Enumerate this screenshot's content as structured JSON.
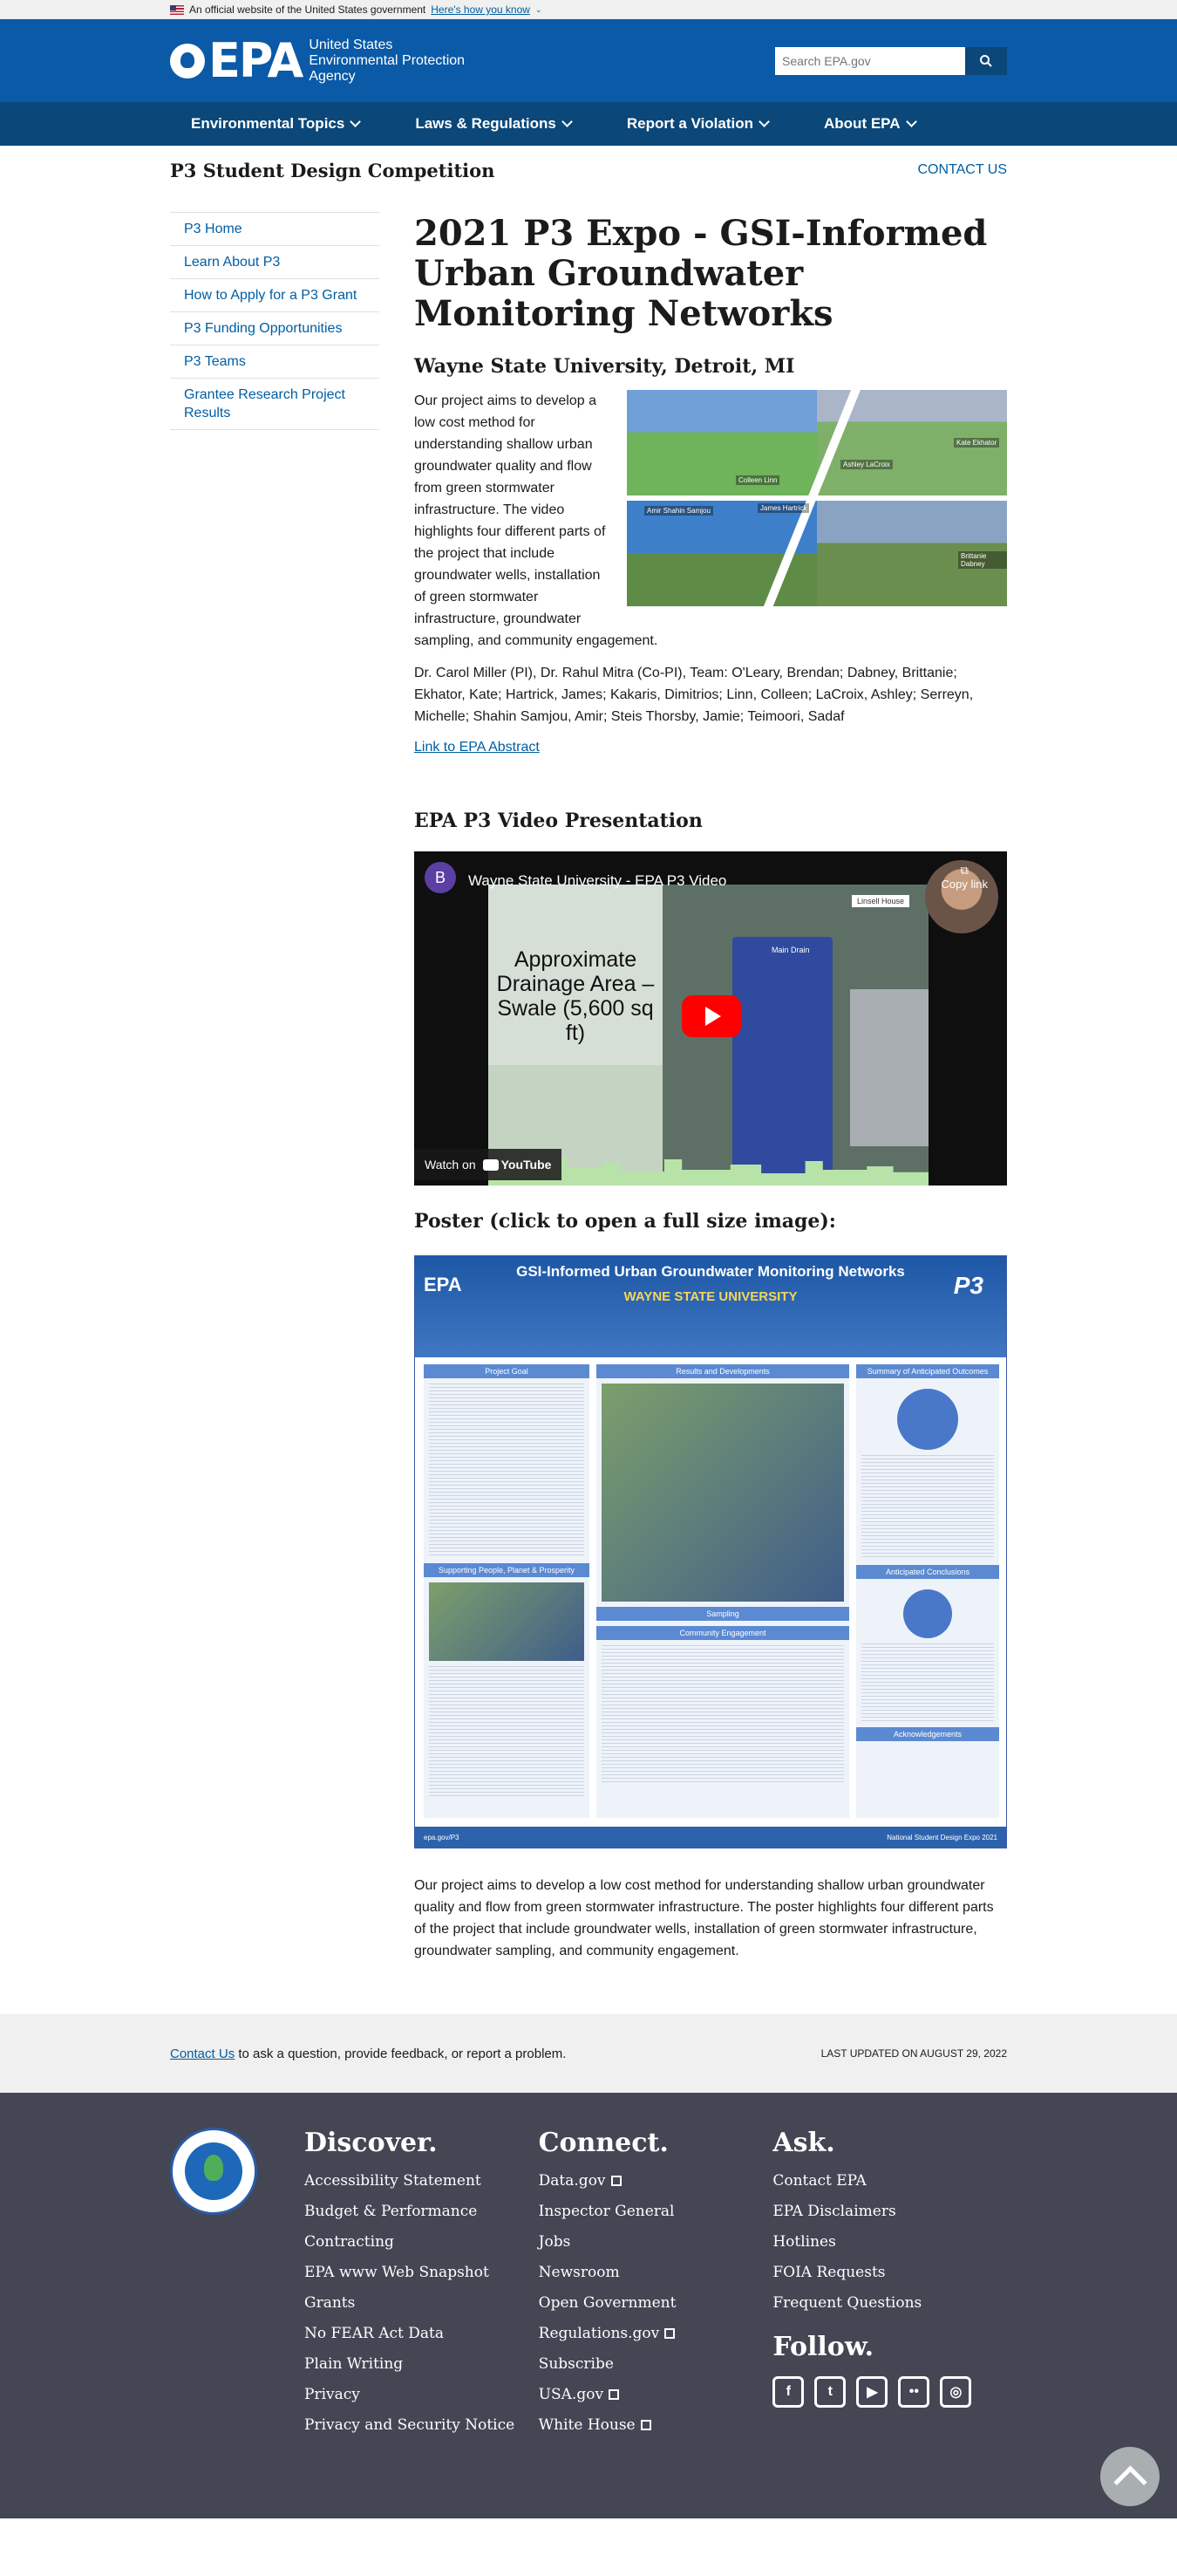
{
  "gov_banner": {
    "text": "An official website of the United States government",
    "link": "Here's how you know"
  },
  "header": {
    "logo": "EPA",
    "agency_name": [
      "United States",
      "Environmental Protection",
      "Agency"
    ],
    "search_placeholder": "Search EPA.gov"
  },
  "nav": {
    "items": [
      "Environmental Topics",
      "Laws & Regulations",
      "Report a Violation",
      "About EPA"
    ]
  },
  "microsite": {
    "title": "P3 Student Design Competition",
    "contact": "CONTACT US"
  },
  "sidebar": {
    "items": [
      "P3 Home",
      "Learn About P3",
      "How to Apply for a P3 Grant",
      "P3 Funding Opportunities",
      "P3 Teams",
      "Grantee Research Project Results"
    ]
  },
  "page": {
    "title": "2021 P3 Expo - GSI-Informed Urban Groundwater Monitoring Networks",
    "subtitle": "Wayne State University, Detroit, MI",
    "intro": "Our project aims to develop a low cost method for understanding shallow urban groundwater quality and flow from green stormwater infrastructure. The video highlights four different parts of the project that include groundwater wells, installation of green stormwater infrastructure, groundwater sampling, and community engagement.",
    "team": "Dr. Carol Miller (PI), Dr. Rahul Mitra (Co-PI), Team: O'Leary, Brendan; Dabney, Brittanie; Ekhator, Kate; Hartrick, James; Kakaris, Dimitrios; Linn, Colleen; LaCroix, Ashley; Serreyn, Michelle; Shahin Samjou, Amir; Steis Thorsby, Jamie; Teimoori, Sadaf",
    "abstract_link": "Link to EPA Abstract",
    "video_heading": "EPA P3 Video Presentation",
    "poster_heading": "Poster (click to open a full size image):",
    "poster_desc": "Our project aims to develop a low cost method for understanding shallow urban groundwater quality and flow from green stormwater infrastructure. The poster highlights four different parts of the project that include groundwater wells, installation of green stormwater infrastructure, groundwater sampling, and community engagement."
  },
  "photo_captions": [
    "Colleen Linn",
    "Ashley LaCroix",
    "Kate Ekhator",
    "Amir Shahin Samjou",
    "James Hartrick",
    "Brittanie Dabney"
  ],
  "video": {
    "channel_initial": "B",
    "title": "Wayne State University - EPA P3 Video",
    "copy_link": "Copy link",
    "slide_text": "Approximate Drainage Area – Swale (5,600 sq ft)",
    "map_label_1": "Linsell House",
    "map_label_2": "Main Drain",
    "watch_on": "Watch on",
    "youtube": "YouTube"
  },
  "poster": {
    "logo": "EPA",
    "title": "GSI-Informed Urban Groundwater Monitoring Networks",
    "university": "WAYNE STATE UNIVERSITY",
    "badge": "P3",
    "sections": [
      "Project Goal",
      "Results and Developments",
      "Summary of Anticipated Outcomes",
      "Supporting People, Planet & Prosperity",
      "Sampling",
      "Community Engagement",
      "Anticipated Conclusions",
      "Acknowledgements"
    ],
    "footer_left": "epa.gov/P3",
    "footer_right": "National Student Design Expo 2021"
  },
  "last_updated": {
    "contact_link": "Contact Us",
    "contact_text": " to ask a question, provide feedback, or report a problem.",
    "date": "LAST UPDATED ON AUGUST 29, 2022"
  },
  "footer": {
    "discover": {
      "heading": "Discover.",
      "links": [
        "Accessibility Statement",
        "Budget & Performance",
        "Contracting",
        "EPA www Web Snapshot",
        "Grants",
        "No FEAR Act Data",
        "Plain Writing",
        "Privacy",
        "Privacy and Security Notice"
      ]
    },
    "connect": {
      "heading": "Connect.",
      "links": [
        "Data.gov",
        "Inspector General",
        "Jobs",
        "Newsroom",
        "Open Government",
        "Regulations.gov",
        "Subscribe",
        "USA.gov",
        "White House"
      ]
    },
    "ask": {
      "heading": "Ask.",
      "links": [
        "Contact EPA",
        "EPA Disclaimers",
        "Hotlines",
        "FOIA Requests",
        "Frequent Questions"
      ]
    },
    "follow": {
      "heading": "Follow.",
      "icons": [
        "facebook-icon",
        "twitter-icon",
        "youtube-icon",
        "flickr-icon",
        "instagram-icon"
      ]
    }
  },
  "colors": {
    "header_blue": "#0a5aa7",
    "nav_blue": "#0b4778",
    "link_blue": "#005ea2",
    "footer_gray": "#444654"
  }
}
